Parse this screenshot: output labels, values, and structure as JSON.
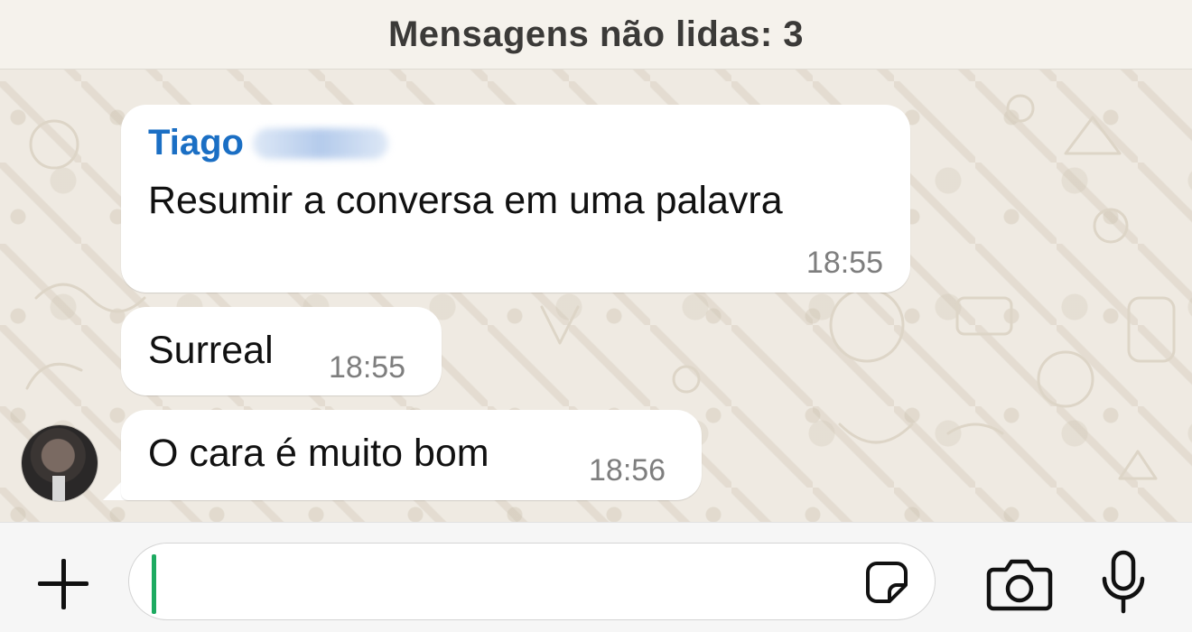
{
  "banner": {
    "unread_label": "Mensagens não lidas: 3"
  },
  "messages": [
    {
      "sender": "Tiago",
      "text": "Resumir a conversa em uma palavra",
      "time": "18:55"
    },
    {
      "text": "Surreal",
      "time": "18:55"
    },
    {
      "text": "O cara é muito bom",
      "time": "18:56"
    }
  ],
  "composer": {
    "value": ""
  },
  "colors": {
    "sender_name": "#1b6fc4",
    "caret": "#1daa61",
    "bubble": "#ffffff",
    "wallpaper": "#efeae2"
  },
  "icons": {
    "attach": "plus-icon",
    "sticker": "sticker-icon",
    "camera": "camera-icon",
    "voice": "microphone-icon"
  }
}
